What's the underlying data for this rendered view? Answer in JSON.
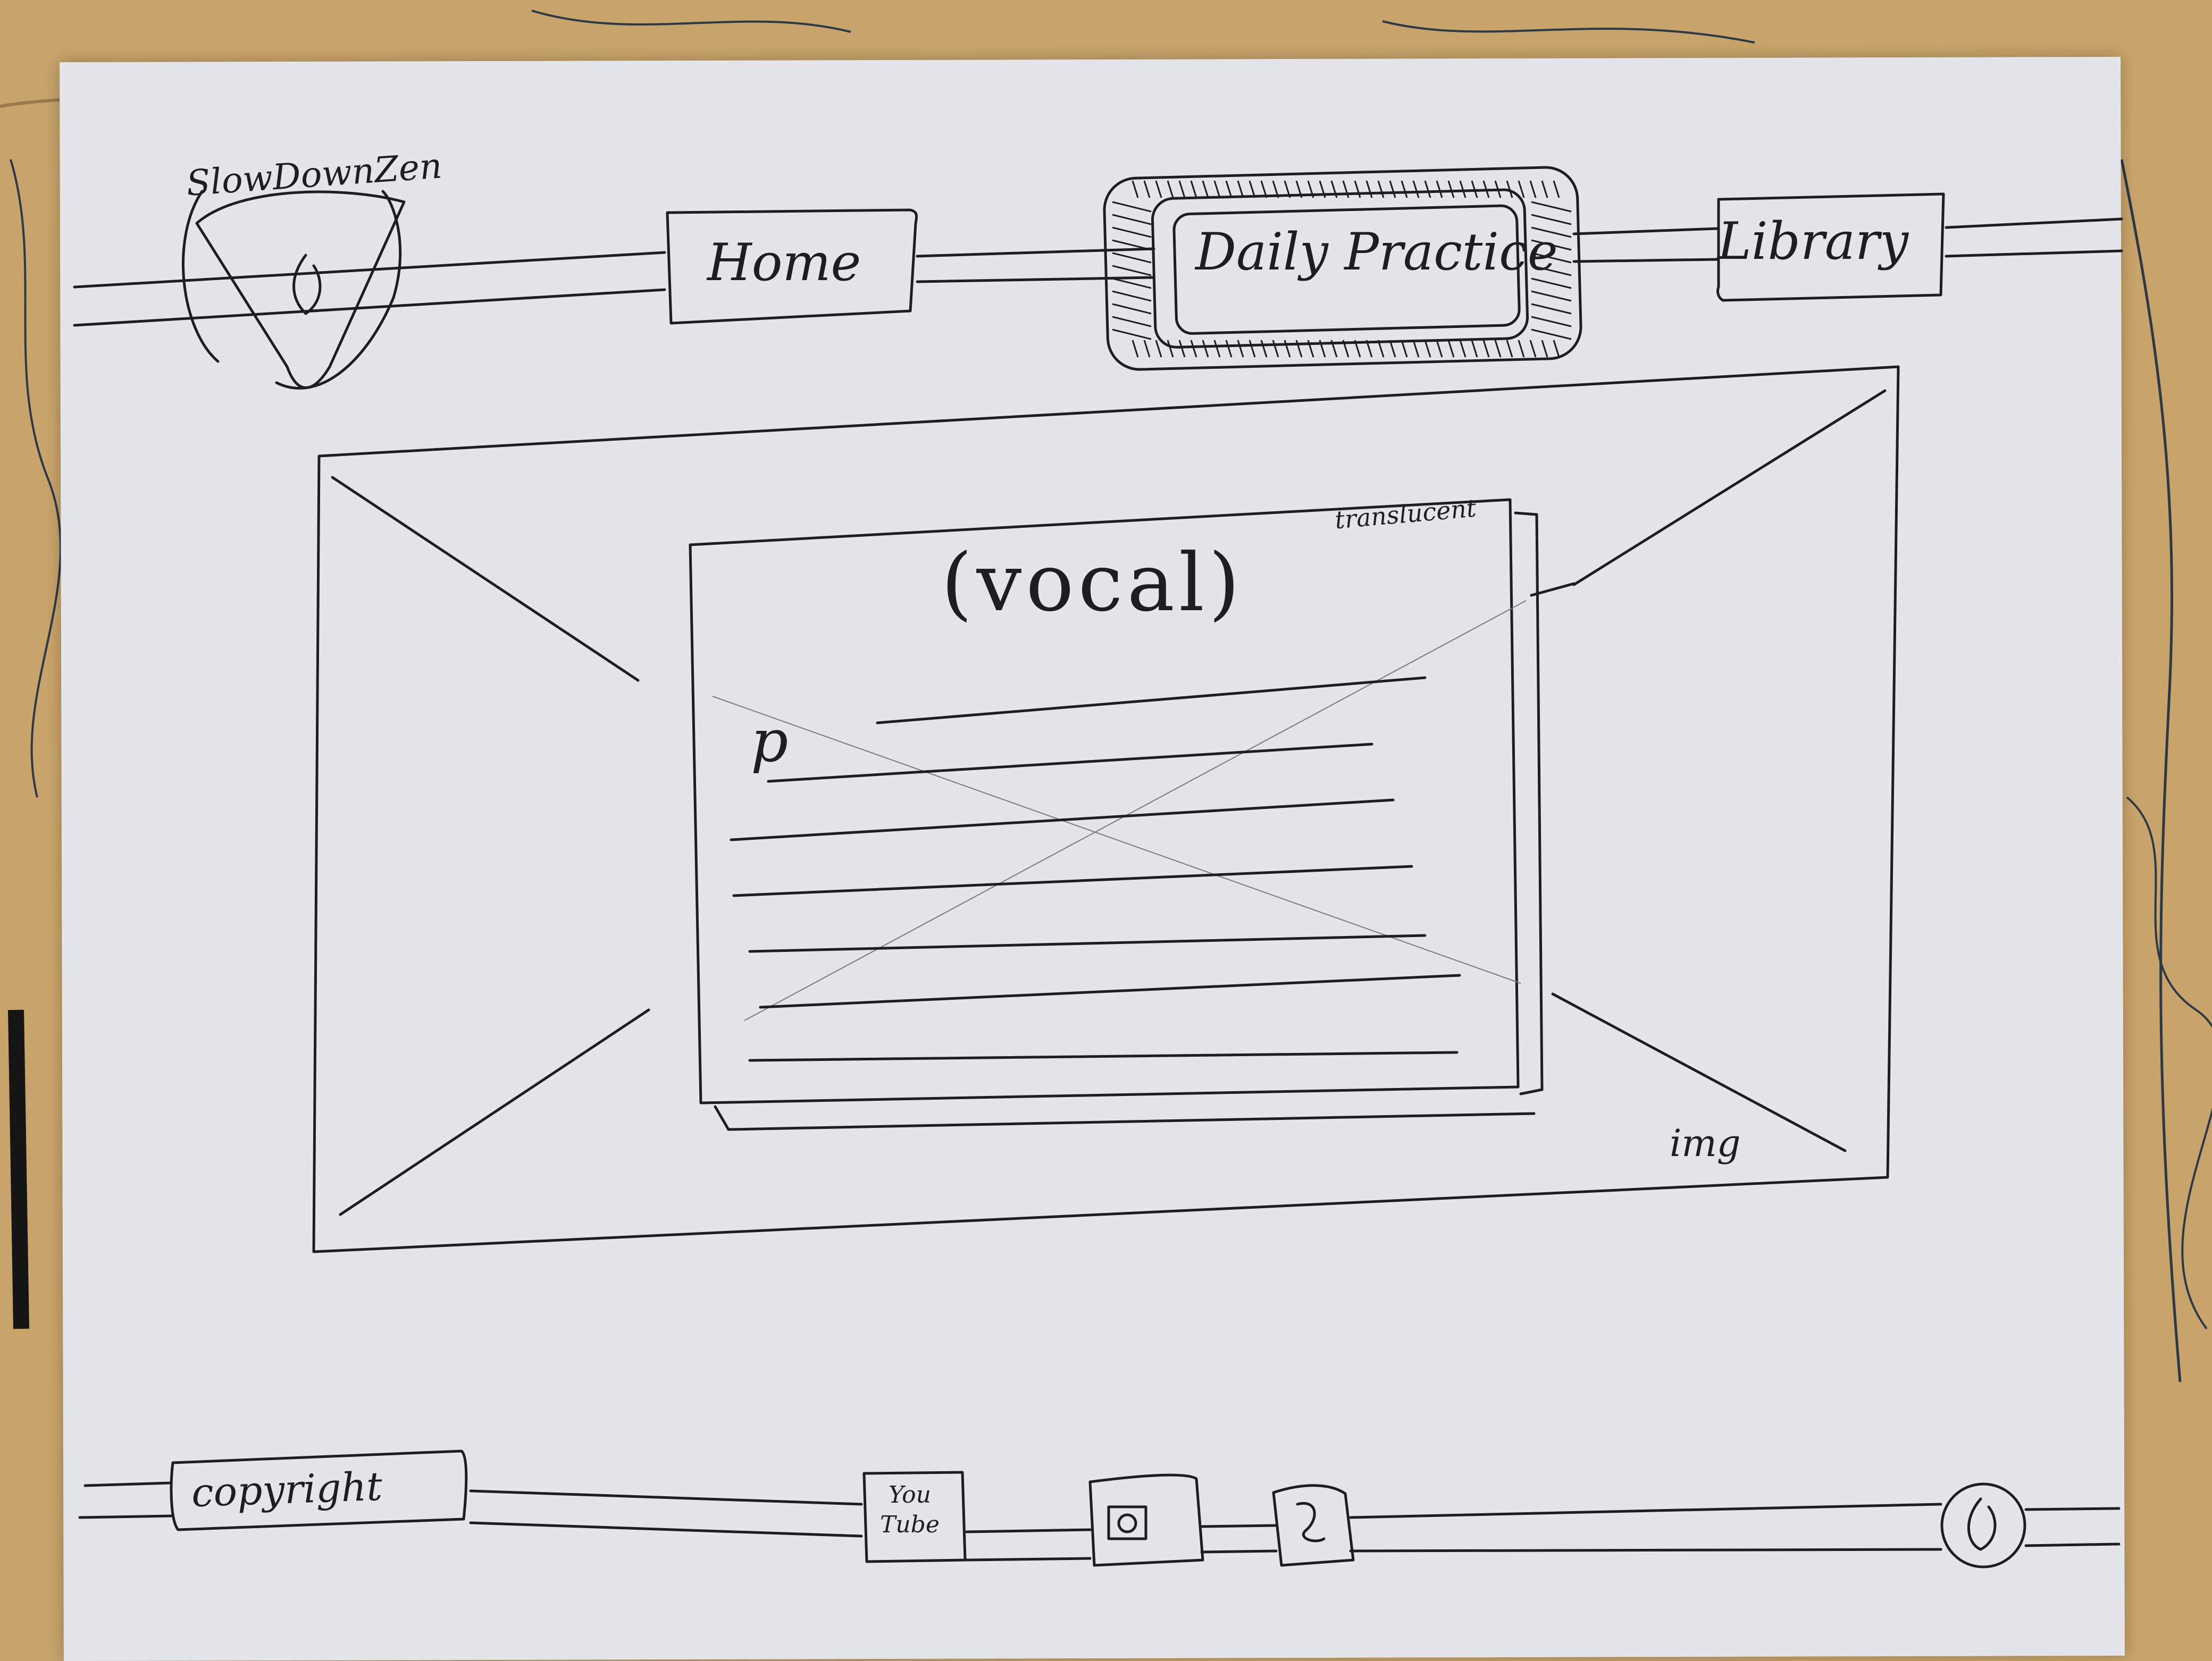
{
  "brand": {
    "name": "SlowDownZen"
  },
  "nav": {
    "items": [
      {
        "id": "home",
        "label": "Home"
      },
      {
        "id": "daily-practice",
        "label": "Daily Practice",
        "active": true
      },
      {
        "id": "library",
        "label": "Library"
      }
    ]
  },
  "hero": {
    "image_note": "img",
    "overlay": {
      "title": "(vocal)",
      "note": "translucent",
      "paragraph_marker": "p"
    }
  },
  "footer": {
    "copyright": "copyright",
    "social": [
      {
        "icon": "youtube-icon",
        "label_line1": "You",
        "label_line2": "Tube"
      },
      {
        "icon": "instagram-icon"
      },
      {
        "icon": "facebook-icon"
      }
    ],
    "logo_icon": "flame-icon"
  },
  "colors": {
    "ink": "#1e1e22",
    "paper": "#e4e5ea",
    "desk": "#c9a46a"
  }
}
